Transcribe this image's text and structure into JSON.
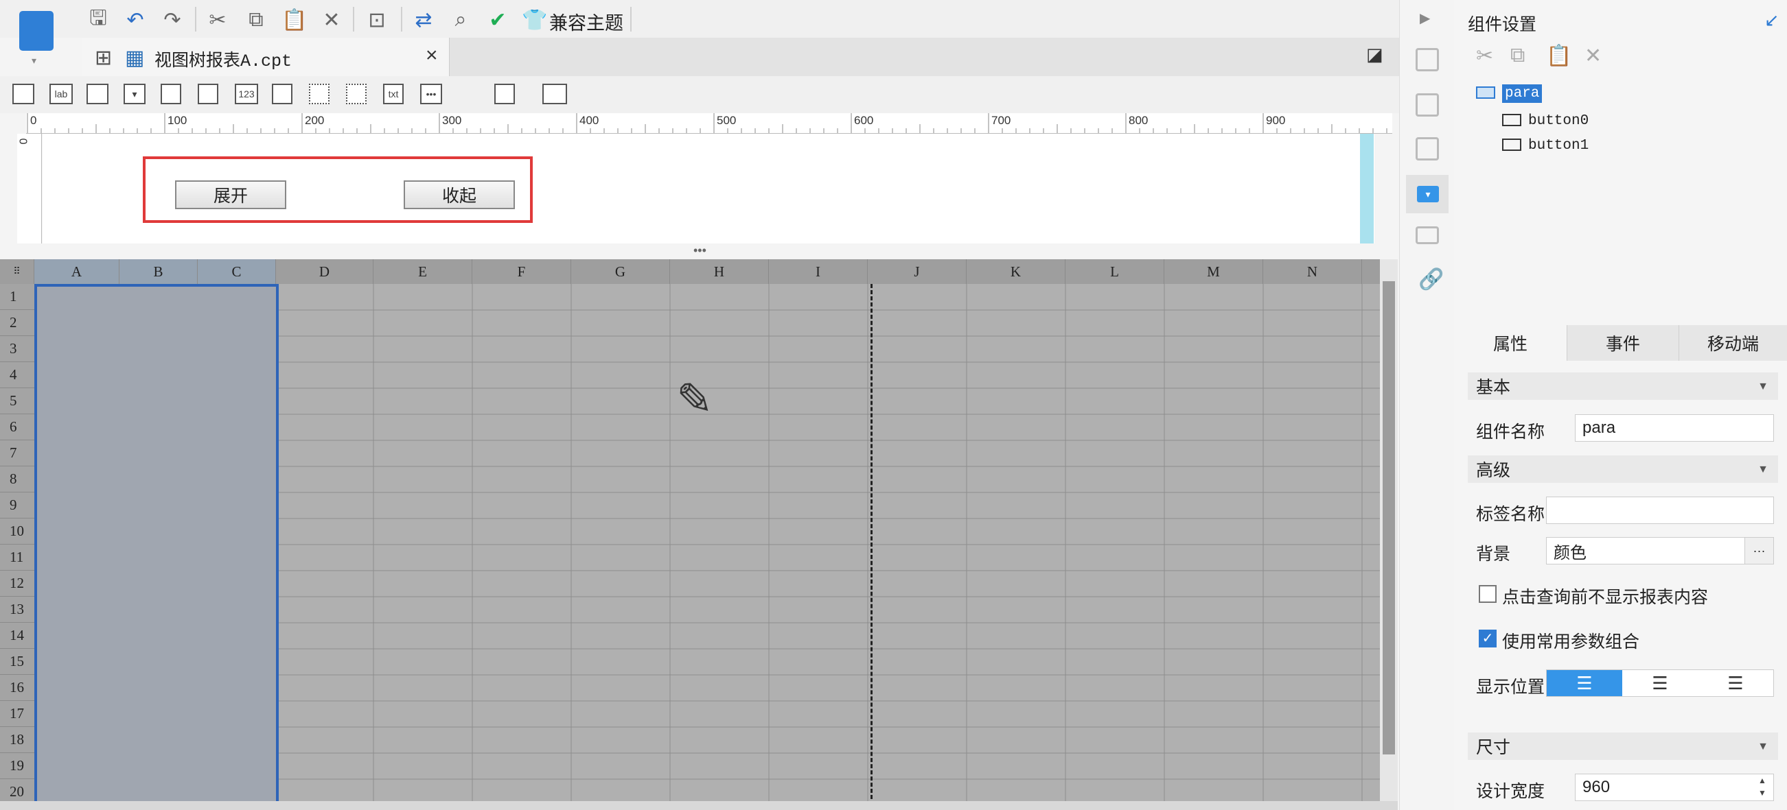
{
  "toolbar": {
    "theme_label": "兼容主题",
    "icons": [
      "save-icon",
      "undo-icon",
      "redo-icon",
      "cut-icon",
      "copy-icon",
      "paste-icon",
      "delete-icon",
      "text-preview-icon",
      "swap-icon",
      "search-preview-icon",
      "check-icon",
      "shirt-icon"
    ]
  },
  "tab": {
    "file_name": "视图树报表A.cpt",
    "close": "×"
  },
  "widget_bar": {
    "items": [
      "",
      "lab",
      "",
      "▾",
      "",
      "",
      "123",
      "",
      "",
      "",
      "txt",
      "•••",
      "",
      "",
      ""
    ]
  },
  "ruler": {
    "zero": "0",
    "ticks": [
      "0",
      "100",
      "200",
      "300",
      "400",
      "500",
      "600",
      "700",
      "800",
      "900"
    ]
  },
  "parameter_canvas": {
    "expand_button": "展开",
    "collapse_button": "收起"
  },
  "sheet": {
    "columns": [
      "A",
      "B",
      "C",
      "D",
      "E",
      "F",
      "G",
      "H",
      "I",
      "J",
      "K",
      "L",
      "M",
      "N"
    ],
    "rows": [
      "1",
      "2",
      "3",
      "4",
      "5",
      "6",
      "7",
      "8",
      "9",
      "10",
      "11",
      "12",
      "13",
      "14",
      "15",
      "16",
      "17",
      "18",
      "19",
      "20"
    ]
  },
  "panel": {
    "title": "组件设置",
    "tree": {
      "root": "para",
      "children": [
        "button0",
        "button1"
      ]
    },
    "tabs": [
      "属性",
      "事件",
      "移动端"
    ],
    "sections": {
      "basic": "基本",
      "advanced": "高级",
      "size": "尺寸"
    },
    "fields": {
      "widget_name_label": "组件名称",
      "widget_name_value": "para",
      "tag_name_label": "标签名称",
      "tag_name_value": "",
      "background_label": "背景",
      "background_value": "颜色",
      "more": "···",
      "hide_before_query_label": "点击查询前不显示报表内容",
      "hide_before_query_checked": false,
      "use_common_param_label": "使用常用参数组合",
      "use_common_param_checked": true,
      "display_position_label": "显示位置",
      "design_width_label": "设计宽度",
      "design_width_value": "960"
    }
  },
  "colors": {
    "accent": "#2e7bd3",
    "highlight": "#e03a3a",
    "selection": "#2e64b8"
  }
}
